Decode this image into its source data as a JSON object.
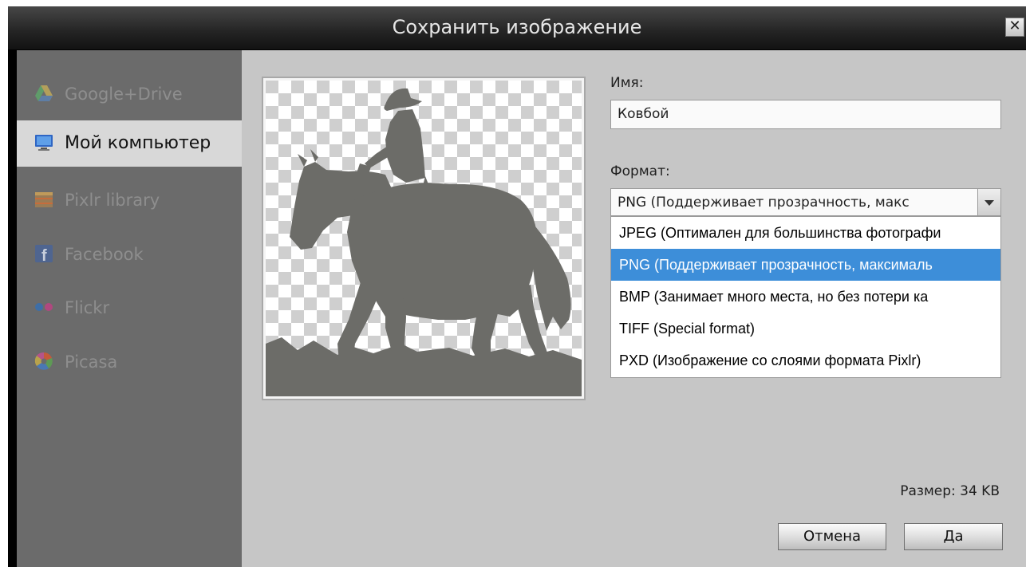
{
  "window": {
    "title": "Сохранить изображение",
    "close_icon": "close-icon"
  },
  "sidebar": {
    "items": [
      {
        "label": "Google+Drive",
        "icon": "google-drive-icon",
        "active": false
      },
      {
        "label": "Мой компьютер",
        "icon": "computer-monitor-icon",
        "active": true
      },
      {
        "label": "Pixlr library",
        "icon": "pixlr-library-icon",
        "active": false
      },
      {
        "label": "Facebook",
        "icon": "facebook-icon",
        "active": false
      },
      {
        "label": "Flickr",
        "icon": "flickr-icon",
        "active": false
      },
      {
        "label": "Picasa",
        "icon": "picasa-icon",
        "active": false
      }
    ]
  },
  "preview": {
    "subject": "cowboy-on-horse-silhouette",
    "silhouette_color": "#6c6c68"
  },
  "form": {
    "name_label": "Имя:",
    "name_value": "Ковбой",
    "format_label": "Формат:",
    "format_selected": "PNG (Поддерживает прозрачность, макс",
    "format_options": [
      {
        "label": "JPEG (Оптимален для большинства фотографи",
        "selected": false
      },
      {
        "label": "PNG (Поддерживает прозрачность, максималь",
        "selected": true
      },
      {
        "label": "BMP (Занимает много места, но без потери ка",
        "selected": false
      },
      {
        "label": "TIFF (Special format)",
        "selected": false
      },
      {
        "label": "PXD (Изображение со слоями формата Pixlr)",
        "selected": false
      }
    ]
  },
  "footer": {
    "size_text": "Размер: 34 KB",
    "cancel_label": "Отмена",
    "ok_label": "Да"
  },
  "colors": {
    "selection": "#3d8ed9",
    "sidebar_bg": "#6b6b6b",
    "content_bg": "#c6c6c6",
    "active_item_bg": "#d8d8d8"
  }
}
